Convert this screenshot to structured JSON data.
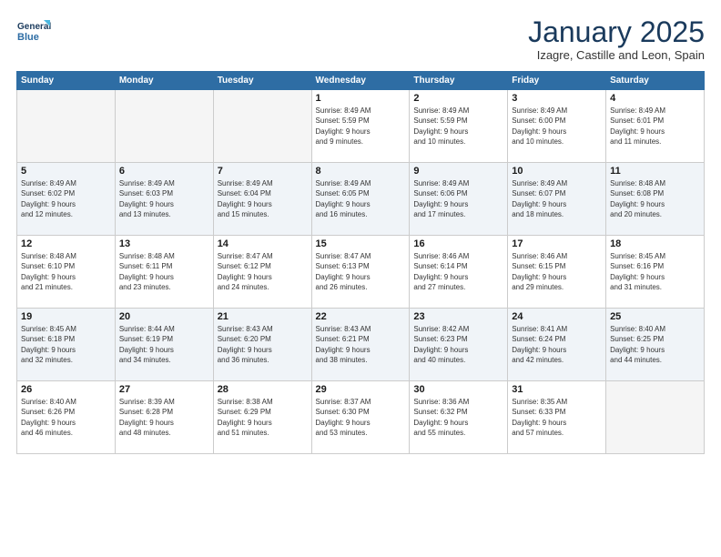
{
  "logo": {
    "line1": "General",
    "line2": "Blue"
  },
  "title": "January 2025",
  "location": "Izagre, Castille and Leon, Spain",
  "weekdays": [
    "Sunday",
    "Monday",
    "Tuesday",
    "Wednesday",
    "Thursday",
    "Friday",
    "Saturday"
  ],
  "weeks": [
    [
      {
        "day": "",
        "info": ""
      },
      {
        "day": "",
        "info": ""
      },
      {
        "day": "",
        "info": ""
      },
      {
        "day": "1",
        "info": "Sunrise: 8:49 AM\nSunset: 5:59 PM\nDaylight: 9 hours\nand 9 minutes."
      },
      {
        "day": "2",
        "info": "Sunrise: 8:49 AM\nSunset: 5:59 PM\nDaylight: 9 hours\nand 10 minutes."
      },
      {
        "day": "3",
        "info": "Sunrise: 8:49 AM\nSunset: 6:00 PM\nDaylight: 9 hours\nand 10 minutes."
      },
      {
        "day": "4",
        "info": "Sunrise: 8:49 AM\nSunset: 6:01 PM\nDaylight: 9 hours\nand 11 minutes."
      }
    ],
    [
      {
        "day": "5",
        "info": "Sunrise: 8:49 AM\nSunset: 6:02 PM\nDaylight: 9 hours\nand 12 minutes."
      },
      {
        "day": "6",
        "info": "Sunrise: 8:49 AM\nSunset: 6:03 PM\nDaylight: 9 hours\nand 13 minutes."
      },
      {
        "day": "7",
        "info": "Sunrise: 8:49 AM\nSunset: 6:04 PM\nDaylight: 9 hours\nand 15 minutes."
      },
      {
        "day": "8",
        "info": "Sunrise: 8:49 AM\nSunset: 6:05 PM\nDaylight: 9 hours\nand 16 minutes."
      },
      {
        "day": "9",
        "info": "Sunrise: 8:49 AM\nSunset: 6:06 PM\nDaylight: 9 hours\nand 17 minutes."
      },
      {
        "day": "10",
        "info": "Sunrise: 8:49 AM\nSunset: 6:07 PM\nDaylight: 9 hours\nand 18 minutes."
      },
      {
        "day": "11",
        "info": "Sunrise: 8:48 AM\nSunset: 6:08 PM\nDaylight: 9 hours\nand 20 minutes."
      }
    ],
    [
      {
        "day": "12",
        "info": "Sunrise: 8:48 AM\nSunset: 6:10 PM\nDaylight: 9 hours\nand 21 minutes."
      },
      {
        "day": "13",
        "info": "Sunrise: 8:48 AM\nSunset: 6:11 PM\nDaylight: 9 hours\nand 23 minutes."
      },
      {
        "day": "14",
        "info": "Sunrise: 8:47 AM\nSunset: 6:12 PM\nDaylight: 9 hours\nand 24 minutes."
      },
      {
        "day": "15",
        "info": "Sunrise: 8:47 AM\nSunset: 6:13 PM\nDaylight: 9 hours\nand 26 minutes."
      },
      {
        "day": "16",
        "info": "Sunrise: 8:46 AM\nSunset: 6:14 PM\nDaylight: 9 hours\nand 27 minutes."
      },
      {
        "day": "17",
        "info": "Sunrise: 8:46 AM\nSunset: 6:15 PM\nDaylight: 9 hours\nand 29 minutes."
      },
      {
        "day": "18",
        "info": "Sunrise: 8:45 AM\nSunset: 6:16 PM\nDaylight: 9 hours\nand 31 minutes."
      }
    ],
    [
      {
        "day": "19",
        "info": "Sunrise: 8:45 AM\nSunset: 6:18 PM\nDaylight: 9 hours\nand 32 minutes."
      },
      {
        "day": "20",
        "info": "Sunrise: 8:44 AM\nSunset: 6:19 PM\nDaylight: 9 hours\nand 34 minutes."
      },
      {
        "day": "21",
        "info": "Sunrise: 8:43 AM\nSunset: 6:20 PM\nDaylight: 9 hours\nand 36 minutes."
      },
      {
        "day": "22",
        "info": "Sunrise: 8:43 AM\nSunset: 6:21 PM\nDaylight: 9 hours\nand 38 minutes."
      },
      {
        "day": "23",
        "info": "Sunrise: 8:42 AM\nSunset: 6:23 PM\nDaylight: 9 hours\nand 40 minutes."
      },
      {
        "day": "24",
        "info": "Sunrise: 8:41 AM\nSunset: 6:24 PM\nDaylight: 9 hours\nand 42 minutes."
      },
      {
        "day": "25",
        "info": "Sunrise: 8:40 AM\nSunset: 6:25 PM\nDaylight: 9 hours\nand 44 minutes."
      }
    ],
    [
      {
        "day": "26",
        "info": "Sunrise: 8:40 AM\nSunset: 6:26 PM\nDaylight: 9 hours\nand 46 minutes."
      },
      {
        "day": "27",
        "info": "Sunrise: 8:39 AM\nSunset: 6:28 PM\nDaylight: 9 hours\nand 48 minutes."
      },
      {
        "day": "28",
        "info": "Sunrise: 8:38 AM\nSunset: 6:29 PM\nDaylight: 9 hours\nand 51 minutes."
      },
      {
        "day": "29",
        "info": "Sunrise: 8:37 AM\nSunset: 6:30 PM\nDaylight: 9 hours\nand 53 minutes."
      },
      {
        "day": "30",
        "info": "Sunrise: 8:36 AM\nSunset: 6:32 PM\nDaylight: 9 hours\nand 55 minutes."
      },
      {
        "day": "31",
        "info": "Sunrise: 8:35 AM\nSunset: 6:33 PM\nDaylight: 9 hours\nand 57 minutes."
      },
      {
        "day": "",
        "info": ""
      }
    ]
  ]
}
